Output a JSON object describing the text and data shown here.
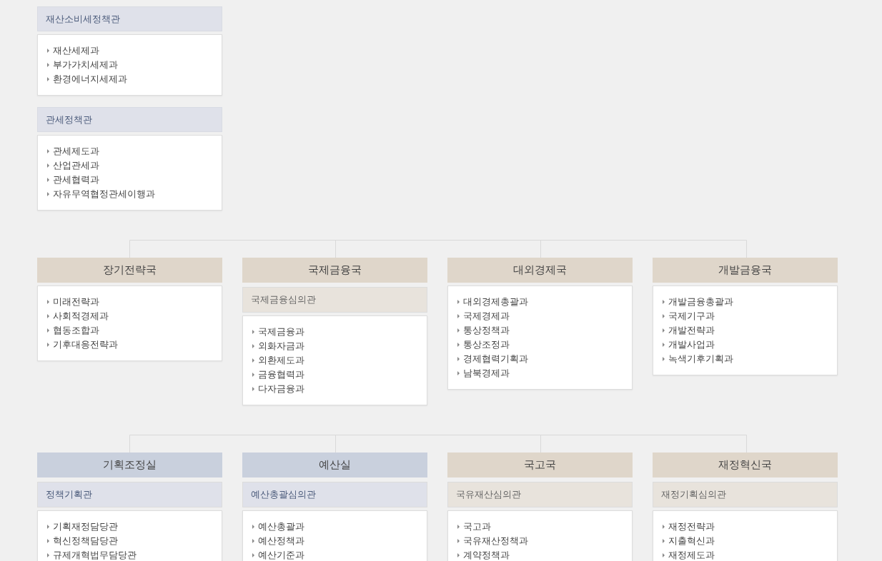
{
  "top_sections": [
    {
      "title": "재산소비세정책관",
      "color": "#dfe1ea",
      "items": [
        "재산세제과",
        "부가가치세제과",
        "환경에너지세제과"
      ]
    },
    {
      "title": "관세정책관",
      "color": "#dfe1ea",
      "items": [
        "관세제도과",
        "산업관세과",
        "관세협력과",
        "자유무역협정관세이행과"
      ]
    }
  ],
  "groups": [
    {
      "bureaus": [
        {
          "title": "장기전략국",
          "color": "#dfd6ca",
          "items": [
            "미래전략과",
            "사회적경제과",
            "협동조합과",
            "기후대응전략과"
          ]
        },
        {
          "title": "국제금융국",
          "color": "#dfd6ca",
          "sub": {
            "title": "국제금융심의관",
            "color": "#e8e3dc"
          },
          "items": [
            "국제금융과",
            "외화자금과",
            "외환제도과",
            "금융협력과",
            "다자금융과"
          ]
        },
        {
          "title": "대외경제국",
          "color": "#dfd6ca",
          "items": [
            "대외경제총괄과",
            "국제경제과",
            "통상정책과",
            "통상조정과",
            "경제협력기획과",
            "남북경제과"
          ]
        },
        {
          "title": "개발금융국",
          "color": "#dfd6ca",
          "items": [
            "개발금융총괄과",
            "국제기구과",
            "개발전략과",
            "개발사업과",
            "녹색기후기획과"
          ]
        }
      ]
    },
    {
      "bureaus": [
        {
          "title": "기획조정실",
          "color": "#c9d0dd",
          "sub": {
            "title": "정책기획관",
            "color": "#dfe1ea"
          },
          "items": [
            "기획재정담당관",
            "혁신정책담당관",
            "규제개혁법무담당관"
          ]
        },
        {
          "title": "예산실",
          "color": "#c9d0dd",
          "sub": {
            "title": "예산총괄심의관",
            "color": "#dfe1ea"
          },
          "items": [
            "예산총괄과",
            "예산정책과",
            "예산기준과"
          ]
        },
        {
          "title": "국고국",
          "color": "#dfd6ca",
          "sub": {
            "title": "국유재산심의관",
            "color": "#e8e3dc"
          },
          "items": [
            "국고과",
            "국유재산정책과",
            "계약정책과"
          ]
        },
        {
          "title": "재정혁신국",
          "color": "#dfd6ca",
          "sub": {
            "title": "재정기획심의관",
            "color": "#e8e3dc"
          },
          "items": [
            "재정전략과",
            "지출혁신과",
            "재정제도과"
          ]
        }
      ]
    }
  ]
}
